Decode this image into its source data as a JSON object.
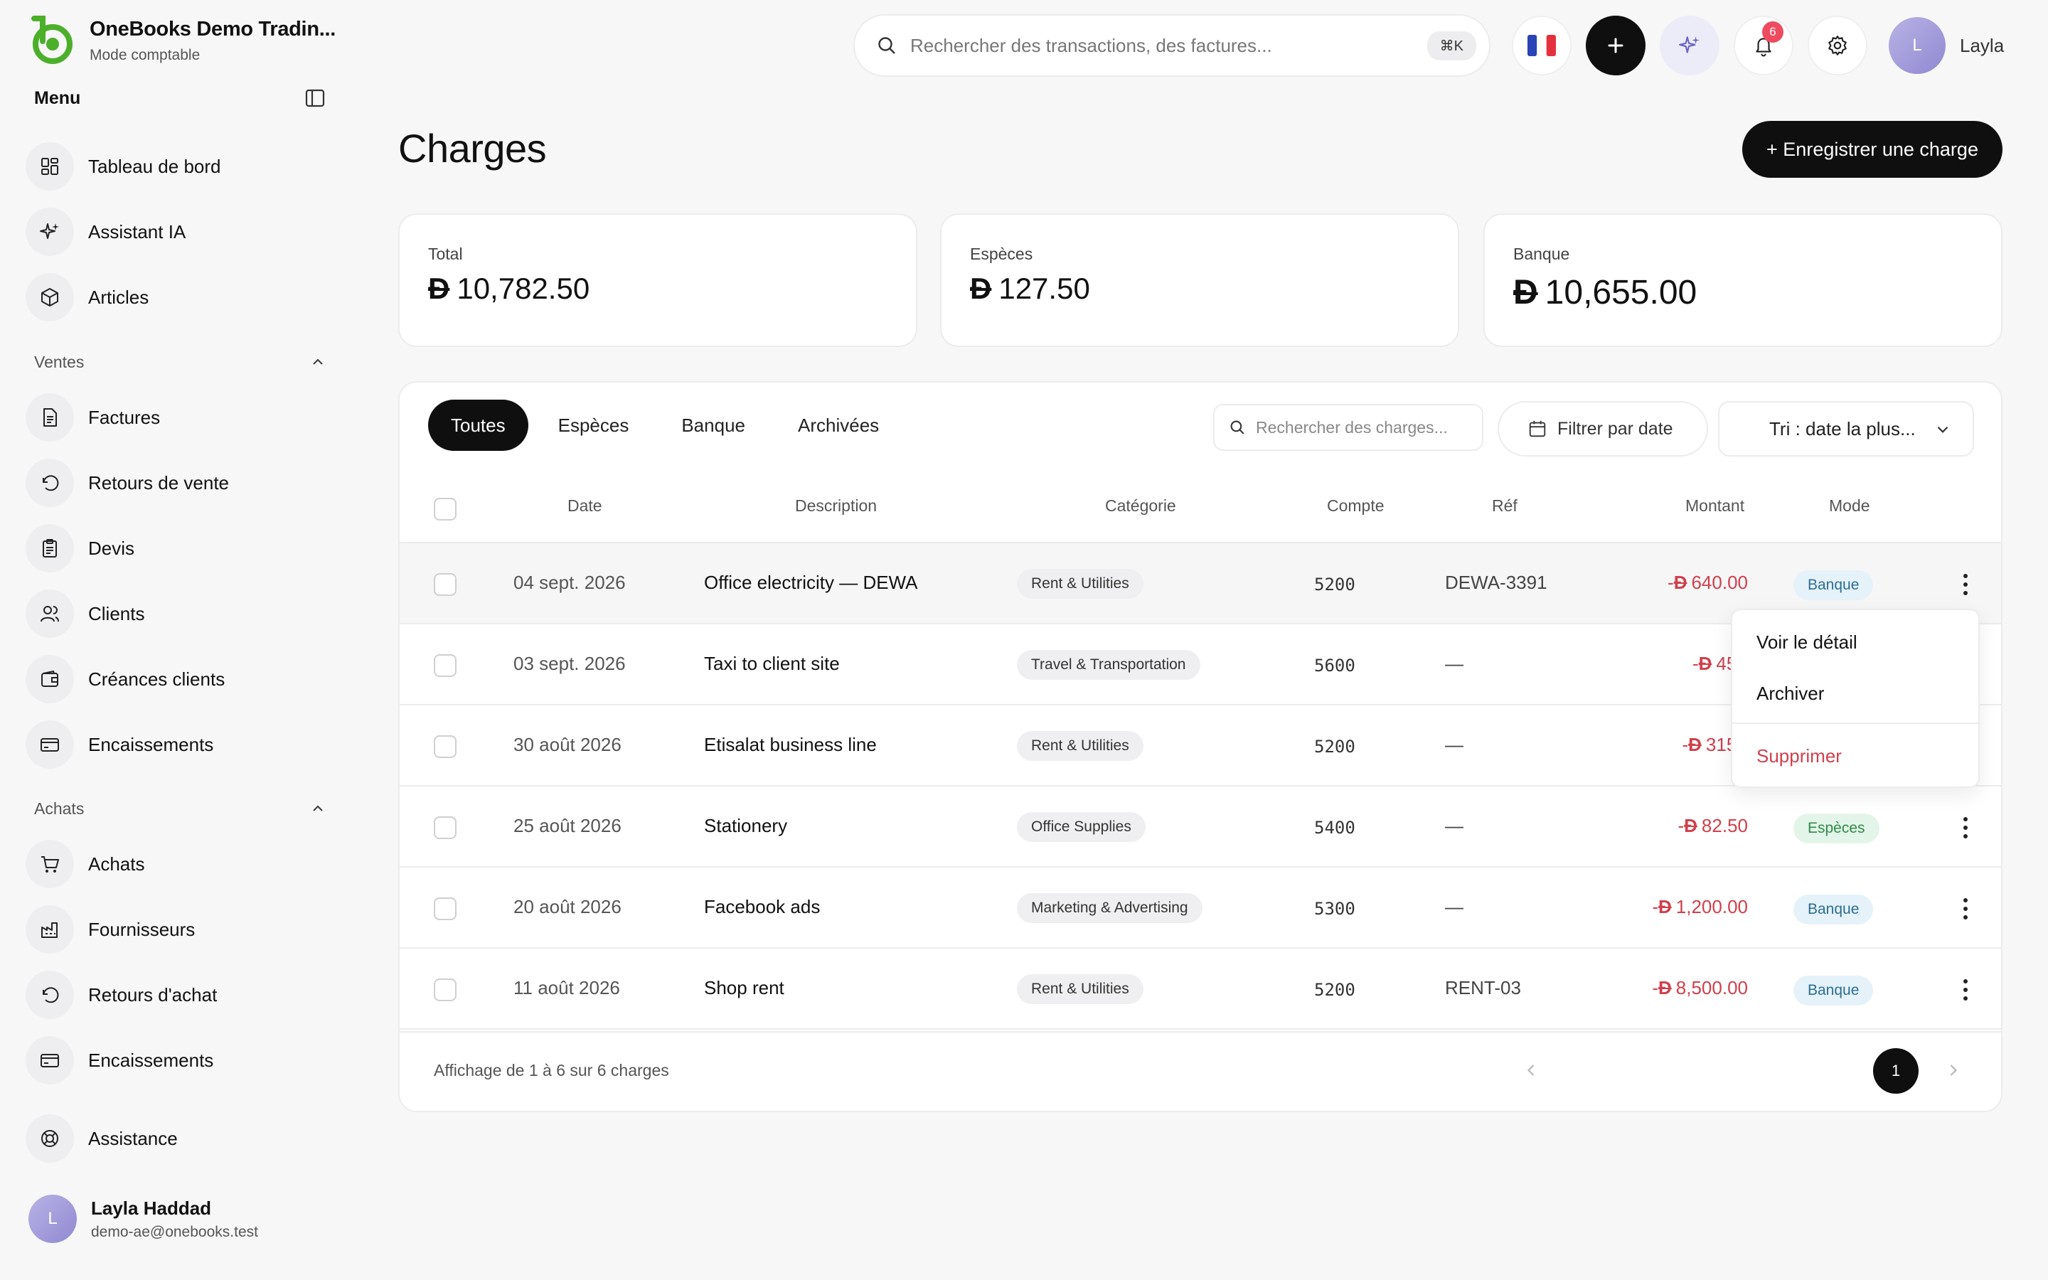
{
  "app": {
    "name": "OneBooks Demo Tradin...",
    "mode": "Mode comptable"
  },
  "sidebar": {
    "menu_title": "Menu",
    "top_items": [
      {
        "label": "Tableau de bord",
        "icon": "dashboard-icon"
      },
      {
        "label": "Assistant IA",
        "icon": "sparkles-icon"
      },
      {
        "label": "Articles",
        "icon": "box-icon"
      }
    ],
    "sales": {
      "label": "Ventes",
      "items": [
        {
          "label": "Factures",
          "icon": "document-icon"
        },
        {
          "label": "Retours de vente",
          "icon": "undo-icon"
        },
        {
          "label": "Devis",
          "icon": "clipboard-icon"
        },
        {
          "label": "Clients",
          "icon": "users-icon"
        },
        {
          "label": "Créances clients",
          "icon": "wallet-icon"
        },
        {
          "label": "Encaissements",
          "icon": "card-icon"
        }
      ]
    },
    "purchases": {
      "label": "Achats",
      "items": [
        {
          "label": "Achats",
          "icon": "cart-icon"
        },
        {
          "label": "Fournisseurs",
          "icon": "factory-icon"
        },
        {
          "label": "Retours d'achat",
          "icon": "undo-icon"
        },
        {
          "label": "Encaissements",
          "icon": "card-icon"
        }
      ]
    },
    "support": {
      "label": "Assistance",
      "icon": "lifebuoy-icon"
    },
    "user": {
      "initial": "L",
      "name": "Layla Haddad",
      "email": "demo-ae@onebooks.test"
    }
  },
  "topbar": {
    "search_placeholder": "Rechercher des transactions, des factures...",
    "shortcut": "⌘K",
    "notifications_count": "6",
    "user_initial": "L",
    "user_name": "Layla"
  },
  "page": {
    "title": "Charges",
    "primary_action": "+ Enregistrer une charge",
    "currency_symbol": "Đ"
  },
  "summary": [
    {
      "label": "Total",
      "value": "10,782.50"
    },
    {
      "label": "Espèces",
      "value": "127.50"
    },
    {
      "label": "Banque",
      "value": "10,655.00"
    }
  ],
  "tabs": [
    {
      "label": "Toutes",
      "active": true
    },
    {
      "label": "Espèces",
      "active": false
    },
    {
      "label": "Banque",
      "active": false
    },
    {
      "label": "Archivées",
      "active": false
    }
  ],
  "toolbar": {
    "search_placeholder": "Rechercher des charges...",
    "filter_label": "Filtrer par date",
    "sort_label": "Tri : date la plus..."
  },
  "table": {
    "headers": {
      "date": "Date",
      "description": "Description",
      "category": "Catégorie",
      "account": "Compte",
      "ref": "Réf",
      "amount": "Montant",
      "mode": "Mode"
    },
    "rows": [
      {
        "date": "04 sept. 2026",
        "description": "Office electricity — DEWA",
        "category": "Rent & Utilities",
        "account": "5200",
        "ref": "DEWA-3391",
        "amount": "640.00",
        "mode": "Banque"
      },
      {
        "date": "03 sept. 2026",
        "description": "Taxi to client site",
        "category": "Travel & Transportation",
        "account": "5600",
        "ref": "—",
        "amount": "45.0",
        "mode": ""
      },
      {
        "date": "30 août 2026",
        "description": "Etisalat business line",
        "category": "Rent & Utilities",
        "account": "5200",
        "ref": "—",
        "amount": "315.0",
        "mode": ""
      },
      {
        "date": "25 août 2026",
        "description": "Stationery",
        "category": "Office Supplies",
        "account": "5400",
        "ref": "—",
        "amount": "82.50",
        "mode": "Espèces"
      },
      {
        "date": "20 août 2026",
        "description": "Facebook ads",
        "category": "Marketing & Advertising",
        "account": "5300",
        "ref": "—",
        "amount": "1,200.00",
        "mode": "Banque"
      },
      {
        "date": "11 août 2026",
        "description": "Shop rent",
        "category": "Rent & Utilities",
        "account": "5200",
        "ref": "RENT-03",
        "amount": "8,500.00",
        "mode": "Banque"
      }
    ]
  },
  "row_menu": {
    "view": "Voir le détail",
    "archive": "Archiver",
    "delete": "Supprimer"
  },
  "pagination": {
    "summary": "Affichage de 1 à 6 sur 6 charges",
    "current_page": "1"
  },
  "colors": {
    "accent_green": "#4caf2a",
    "primary_dark": "#0f0f10",
    "negative_red": "#d0404c",
    "bank_blue": "#2b6d92",
    "cash_green": "#2f8a4a",
    "badge_red": "#ef4b5f"
  }
}
